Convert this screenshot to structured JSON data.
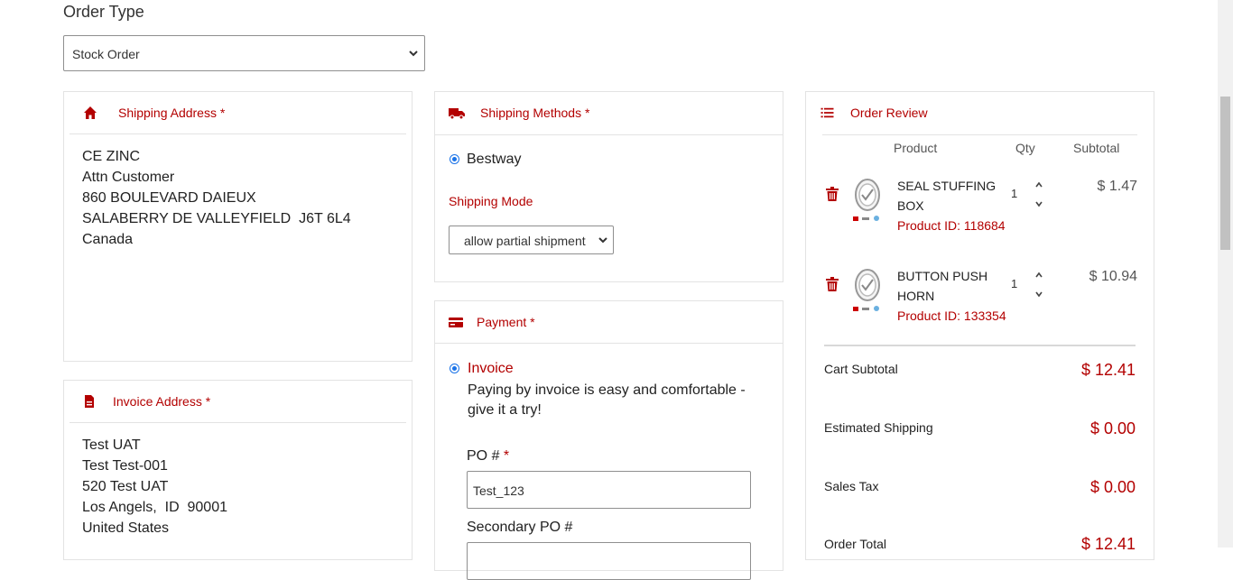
{
  "order_type": {
    "label": "Order Type",
    "selected": "Stock Order"
  },
  "shipping_address": {
    "title": "Shipping Address *",
    "lines": [
      "CE ZINC",
      "Attn Customer",
      "860 BOULEVARD DAIEUX",
      "SALABERRY DE VALLEYFIELD  J6T 6L4",
      "Canada"
    ]
  },
  "invoice_address": {
    "title": "Invoice Address *",
    "lines": [
      "Test UAT",
      "Test Test-001",
      "520 Test UAT",
      "Los Angels,  ID  90001",
      "United States"
    ]
  },
  "shipping_methods": {
    "title": "Shipping Methods *",
    "option": "Bestway",
    "mode_label": "Shipping Mode",
    "mode_selected": "allow partial shipment"
  },
  "payment": {
    "title": "Payment *",
    "option": "Invoice",
    "description": "Paying by invoice is easy and comfortable - give it a try!",
    "po_label": "PO #",
    "po_required": "*",
    "po_value": "Test_123",
    "secondary_po_label": "Secondary PO #"
  },
  "order_review": {
    "title": "Order Review",
    "headers": {
      "product": "Product",
      "qty": "Qty",
      "subtotal": "Subtotal"
    },
    "items": [
      {
        "name": "SEAL STUFFING BOX",
        "product_id": "Product ID: 118684",
        "qty": "1",
        "price": "$ 1.47"
      },
      {
        "name": "BUTTON PUSH HORN",
        "product_id": "Product ID: 133354",
        "qty": "1",
        "price": "$ 10.94"
      }
    ],
    "summary": {
      "cart_subtotal_label": "Cart Subtotal",
      "cart_subtotal": "$ 12.41",
      "shipping_label": "Estimated Shipping",
      "shipping": "$ 0.00",
      "tax_label": "Sales Tax",
      "tax": "$ 0.00",
      "total_label": "Order Total",
      "total": "$ 12.41"
    }
  },
  "icons": {
    "home": "home-icon",
    "document": "document-icon",
    "truck": "truck-icon",
    "card": "credit-card-icon",
    "list": "list-icon",
    "trash": "trash-icon"
  },
  "colors": {
    "accent": "#b30000",
    "radio": "#1a73e8",
    "border": "#e3e3e3"
  }
}
